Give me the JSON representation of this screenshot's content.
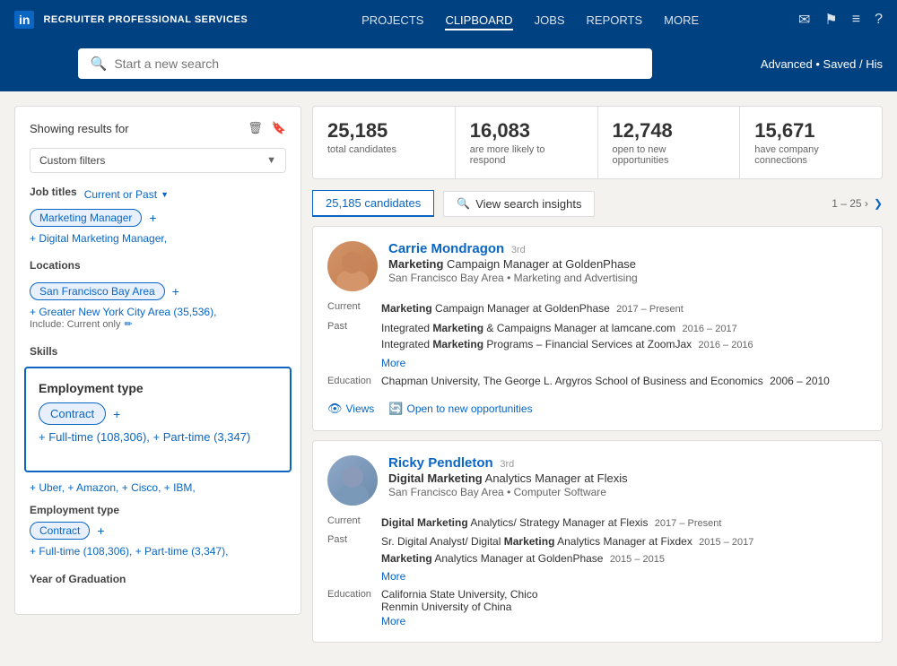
{
  "nav": {
    "logo": "in",
    "brand": "RECRUITER PROFESSIONAL SERVICES",
    "links": [
      "PROJECTS",
      "CLIPBOARD",
      "JOBS",
      "REPORTS",
      "MORE"
    ],
    "search_placeholder": "Start a new search",
    "advanced_label": "Advanced • Saved / His"
  },
  "sidebar": {
    "showing_label": "Showing results for",
    "custom_filters_label": "Custom filters",
    "job_titles_label": "Job titles",
    "job_title_filter": "Current or Past",
    "job_title_tag": "Marketing Manager",
    "job_title_more": "+ Digital Marketing Manager,",
    "locations_label": "Locations",
    "location_tag": "San Francisco Bay Area",
    "location_more": "+ Greater New York City Area (35,536),",
    "location_include": "Include: Current only",
    "skills_label": "Skills",
    "employment_type_highlight_label": "Employment type",
    "employment_tag": "Contract",
    "employment_more": "+ Full-time (108,306), + Part-time (3,347)",
    "employment_type_2_label": "Employment type",
    "employment_tag_2": "Contract",
    "employment_more_2": "+ Full-time (108,306), + Part-time (3,347),",
    "companies_more": "+ Uber, + Amazon, + Cisco, + IBM,",
    "year_of_graduation_label": "Year of Graduation"
  },
  "stats": [
    {
      "number": "25,185",
      "label": "total candidates"
    },
    {
      "number": "16,083",
      "label": "are more likely to respond"
    },
    {
      "number": "12,748",
      "label": "open to new opportunities"
    },
    {
      "number": "15,671",
      "label": "have company connections"
    }
  ],
  "results_bar": {
    "count_label": "25,185 candidates",
    "insights_btn": "View search insights",
    "pagination": "1 – 25 ›"
  },
  "candidates": [
    {
      "id": "carrie",
      "name": "Carrie Mondragon",
      "degree": "3rd",
      "title_bold": "Marketing",
      "title_rest": " Campaign Manager at GoldenPhase",
      "location": "San Francisco Bay Area • Marketing and Advertising",
      "current_label": "Current",
      "current_bold": "Marketing",
      "current_rest": " Campaign Manager at GoldenPhase",
      "current_date": "2017 – Present",
      "past_label": "Past",
      "past_lines": [
        {
          "bold": "Marketing",
          "pre": "Integrated ",
          "mid": " & Campaigns Manager at lamcane.com",
          "date": "2016 – 2017"
        },
        {
          "bold": "Marketing",
          "pre": "Integrated ",
          "mid": " Programs – Financial Services at ZoomJax",
          "date": "2016 – 2016"
        }
      ],
      "more_label": "More",
      "education_label": "Education",
      "education": "Chapman University, The George L. Argyros School of Business and Economics",
      "education_date": "2006 – 2010",
      "views_label": "Views",
      "open_label": "Open to new opportunities"
    },
    {
      "id": "ricky",
      "name": "Ricky Pendleton",
      "degree": "3rd",
      "title_bold": "Digital Marketing",
      "title_rest": " Analytics Manager at Flexis",
      "location": "San Francisco Bay Area • Computer Software",
      "current_label": "Current",
      "current_bold": "Digital Marketing",
      "current_rest": " Analytics/ Strategy Manager at Flexis",
      "current_date": "2017 – Present",
      "past_label": "Past",
      "past_lines": [
        {
          "bold": "Marketing",
          "pre": "Sr. Digital Analyst/ Digital ",
          "mid": " Analytics Manager at Fixdex",
          "date": "2015 – 2017"
        },
        {
          "bold": "Marketing",
          "pre": "",
          "mid": " Analytics Manager at GoldenPhase",
          "date": "2015 – 2015"
        }
      ],
      "more_label": "More",
      "education_label": "Education",
      "education": "California State University, Chico\nRenmin University of China",
      "education_date": "",
      "more_edu_label": "More"
    }
  ]
}
